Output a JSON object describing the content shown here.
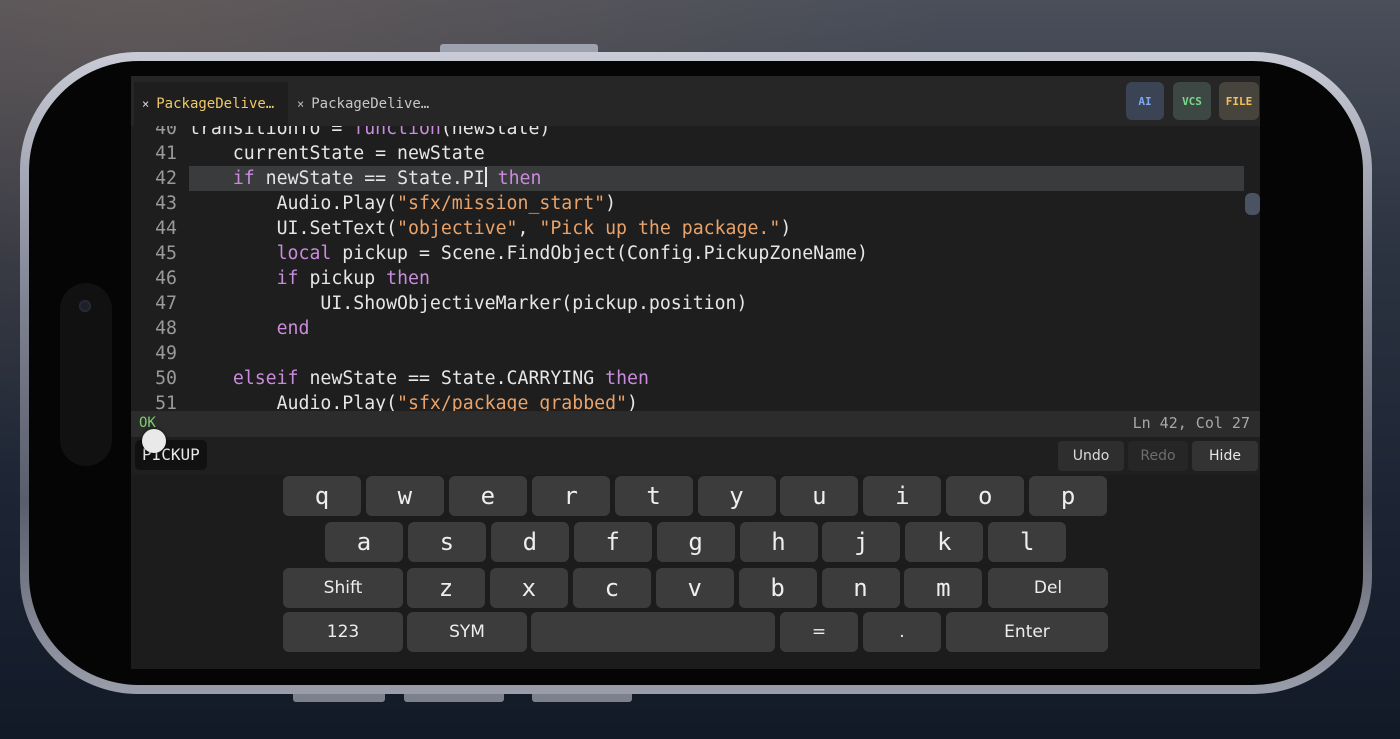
{
  "tabs": [
    {
      "label": "PackageDelive…",
      "close": "×",
      "active": true
    },
    {
      "label": "PackageDelive…",
      "close": "×",
      "active": false
    }
  ],
  "toolbar": {
    "ai_label": "AI",
    "vcs_label": "VCS",
    "file_label": "FILE"
  },
  "code": {
    "lines": [
      {
        "num": "40",
        "text": "transitionTo = function(newState)"
      },
      {
        "num": "41",
        "text": "    currentState = newState"
      },
      {
        "num": "42",
        "text": "    if newState == State.PI then"
      },
      {
        "num": "43",
        "text": "        Audio.Play(\"sfx/mission_start\")"
      },
      {
        "num": "44",
        "text": "        UI.SetText(\"objective\", \"Pick up the package.\")"
      },
      {
        "num": "45",
        "text": "        local pickup = Scene.FindObject(Config.PickupZoneName)"
      },
      {
        "num": "46",
        "text": "        if pickup then"
      },
      {
        "num": "47",
        "text": "            UI.ShowObjectiveMarker(pickup.position)"
      },
      {
        "num": "48",
        "text": "        end"
      },
      {
        "num": "49",
        "text": ""
      },
      {
        "num": "50",
        "text": "    elseif newState == State.CARRYING then"
      },
      {
        "num": "51",
        "text": "        Audio.Play(\"sfx/package_grabbed\")"
      }
    ],
    "current_line": "42"
  },
  "status": {
    "ok": "OK",
    "position": "Ln 42, Col 27"
  },
  "suggestion": "PICKUP",
  "edit": {
    "undo": "Undo",
    "redo": "Redo",
    "hide": "Hide"
  },
  "keyboard": {
    "row1": [
      "q",
      "w",
      "e",
      "r",
      "t",
      "y",
      "u",
      "i",
      "o",
      "p"
    ],
    "row2": [
      "a",
      "s",
      "d",
      "f",
      "g",
      "h",
      "j",
      "k",
      "l"
    ],
    "row3": {
      "shift": "Shift",
      "keys": [
        "z",
        "x",
        "c",
        "v",
        "b",
        "n",
        "m"
      ],
      "del": "Del"
    },
    "row4": {
      "num": "123",
      "sym": "SYM",
      "space": "",
      "eq": "=",
      "dot": ".",
      "enter": "Enter"
    }
  },
  "colors": {
    "keyword": "#c98bdc",
    "string": "#e9a36a",
    "ok": "#7ccf6e",
    "active_tab": "#f0c869"
  }
}
